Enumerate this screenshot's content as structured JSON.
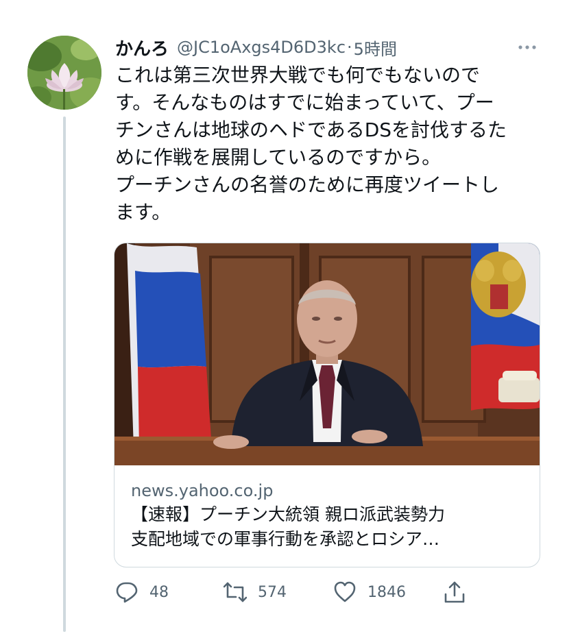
{
  "tweet": {
    "display_name": "かんろ",
    "handle": "@JC1oAxgs4D6D3kc",
    "separator": "·",
    "time": "5時間",
    "text_lines": [
      "これは第三次世界大戦でも何でもないので",
      "す。そんなものはすでに始まっていて、プー",
      "チンさんは地球のヘドであるDSを討伐するた",
      "めに作戦を展開しているのですから。",
      "プーチンさんの名誉のために再度ツイートし",
      "ます。"
    ]
  },
  "link_card": {
    "domain": "news.yahoo.co.jp",
    "title_lines": [
      "【速報】プーチン大統領 親ロ派武装勢力",
      "支配地域での軍事行動を承認とロシア…"
    ]
  },
  "actions": {
    "replies": "48",
    "retweets": "574",
    "likes": "1846"
  },
  "icons": {
    "avatar": "lotus-flower-avatar",
    "more": "more-options-icon",
    "reply": "reply-icon",
    "retweet": "retweet-icon",
    "like": "heart-icon",
    "share": "share-icon"
  },
  "colors": {
    "text": "#0f1419",
    "secondary": "#536471",
    "border": "#cfd9de"
  }
}
